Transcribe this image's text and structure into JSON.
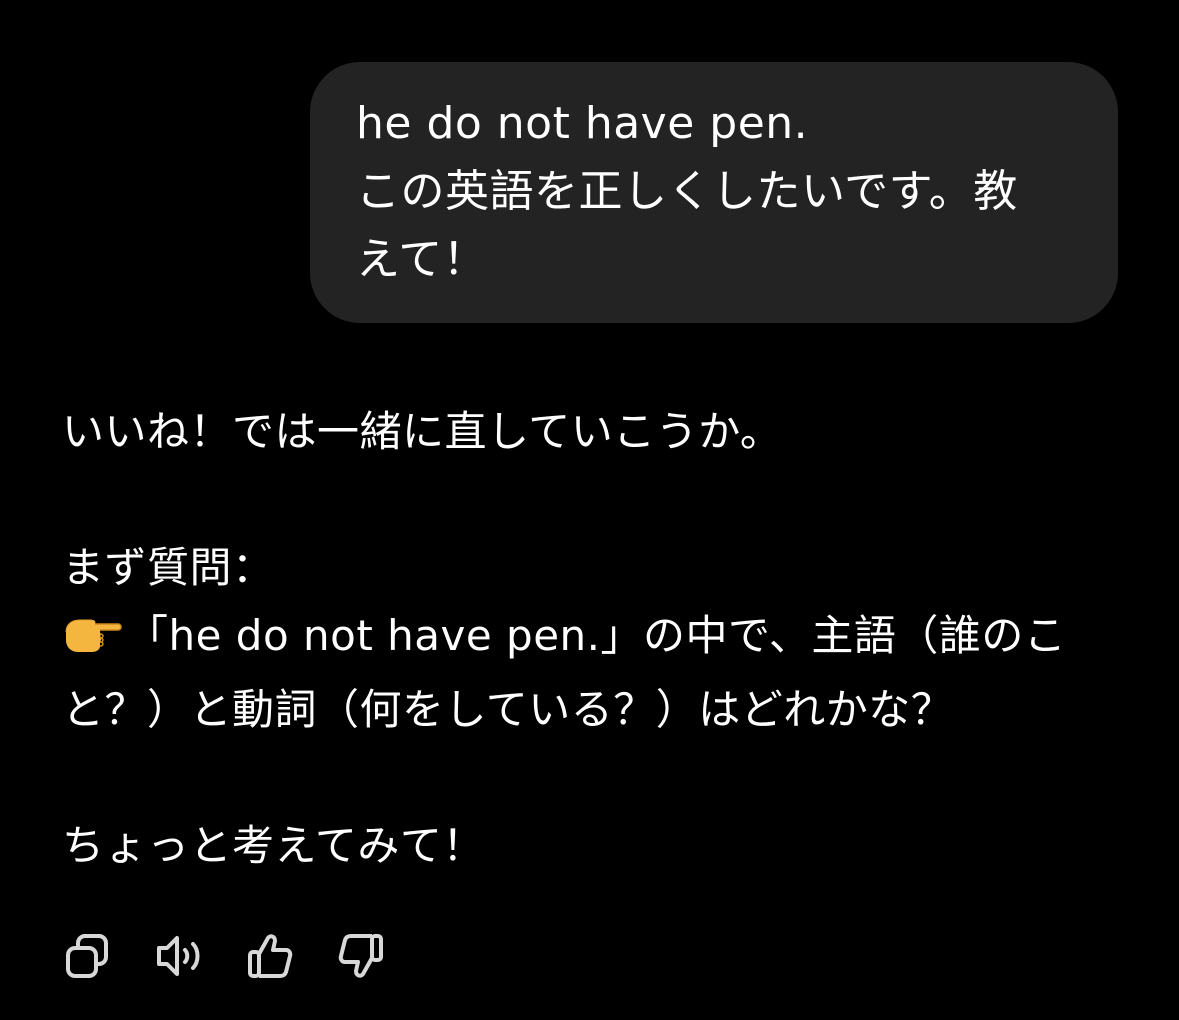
{
  "user_message": {
    "lines": [
      "he do not have pen.",
      "この英語を正しくしたいです。教",
      "えて！"
    ]
  },
  "assistant_message": {
    "line1": "いいね！では一緒に直していこうか。",
    "line2": "まず質問：",
    "line3_text": "「he do not have pen.」の中で、主語（誰のこ",
    "line4": "と？）と動詞（何をしている？）はどれかな？",
    "line5": "ちょっと考えてみて！",
    "pointer_icon": "backhand-index-pointing-right-emoji"
  },
  "actions": {
    "copy_icon": "copy-icon",
    "read_aloud_icon": "speaker-icon",
    "good_icon": "thumbs-up-icon",
    "bad_icon": "thumbs-down-icon"
  },
  "colors": {
    "background": "#000000",
    "bubble": "#232323",
    "text": "#ffffff",
    "icon": "#d8d8d8"
  }
}
